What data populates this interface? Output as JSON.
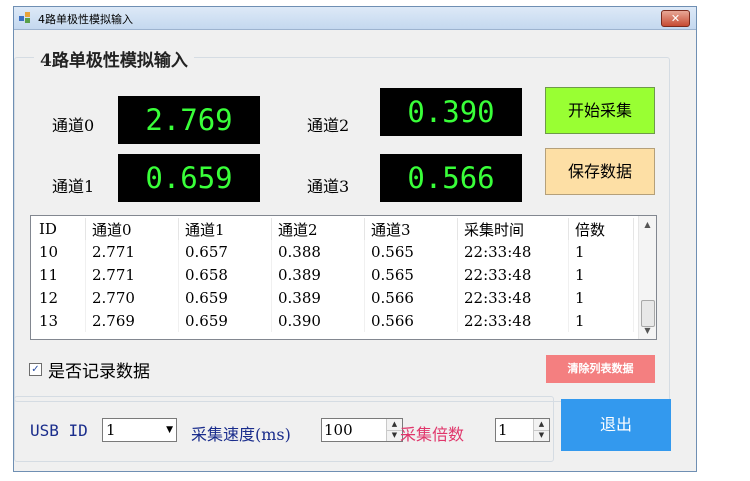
{
  "window": {
    "title": "4路单极性模拟输入",
    "close_label": "✕"
  },
  "group": {
    "title": "4路单极性模拟输入"
  },
  "channels": [
    {
      "label": "通道0",
      "value": "2.769"
    },
    {
      "label": "通道1",
      "value": "0.659"
    },
    {
      "label": "通道2",
      "value": "0.390"
    },
    {
      "label": "通道3",
      "value": "0.566"
    }
  ],
  "buttons": {
    "start": "开始采集",
    "save": "保存数据",
    "clear": "清除列表数据",
    "exit": "退出"
  },
  "table": {
    "headers": [
      "ID",
      "通道0",
      "通道1",
      "通道2",
      "通道3",
      "采集时间",
      "倍数"
    ],
    "rows": [
      [
        "10",
        "2.771",
        "0.657",
        "0.388",
        "0.565",
        "22:33:48",
        "1"
      ],
      [
        "11",
        "2.771",
        "0.658",
        "0.389",
        "0.565",
        "22:33:48",
        "1"
      ],
      [
        "12",
        "2.770",
        "0.659",
        "0.389",
        "0.566",
        "22:33:48",
        "1"
      ],
      [
        "13",
        "2.769",
        "0.659",
        "0.390",
        "0.566",
        "22:33:48",
        "1"
      ]
    ]
  },
  "record": {
    "checked": true,
    "label": "是否记录数据"
  },
  "settings": {
    "usb_label": "USB ID",
    "usb_value": "1",
    "speed_label": "采集速度(ms)",
    "speed_value": "100",
    "mult_label": "采集倍数",
    "mult_value": "1"
  },
  "icons": {
    "check": "✓",
    "dropdown": "▼",
    "up": "▲",
    "down": "▼"
  },
  "colors": {
    "lcd_text": "#39ff39",
    "start": "#99ff33",
    "save": "#fddfa5",
    "clear": "#f47f80",
    "exit": "#3399ee"
  }
}
